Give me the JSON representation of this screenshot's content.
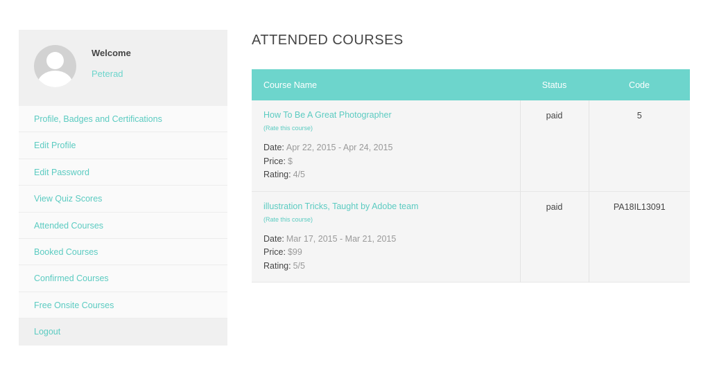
{
  "sidebar": {
    "welcome": "Welcome",
    "username": "Peterad",
    "menu": [
      "Profile, Badges and Certifications",
      "Edit Profile",
      "Edit Password",
      "View Quiz Scores",
      "Attended Courses",
      "Booked Courses",
      "Confirmed Courses",
      "Free Onsite Courses",
      "Logout"
    ]
  },
  "main": {
    "title": "ATTENDED COURSES",
    "table": {
      "headers": {
        "name": "Course Name",
        "status": "Status",
        "code": "Code"
      },
      "labels": {
        "date": "Date:",
        "price": "Price:",
        "rating": "Rating:"
      },
      "rows": [
        {
          "course": "How To Be A Great Photographer",
          "rate": "(Rate this course)",
          "date": "Apr 22, 2015 - Apr 24, 2015",
          "price": "$",
          "rating": "4/5",
          "status": "paid",
          "code": "5"
        },
        {
          "course": "illustration Tricks, Taught by Adobe team",
          "rate": "(Rate this course)",
          "date": "Mar 17, 2015 - Mar 21, 2015",
          "price": "$99",
          "rating": "5/5",
          "status": "paid",
          "code": "PA18IL13091"
        }
      ]
    }
  }
}
